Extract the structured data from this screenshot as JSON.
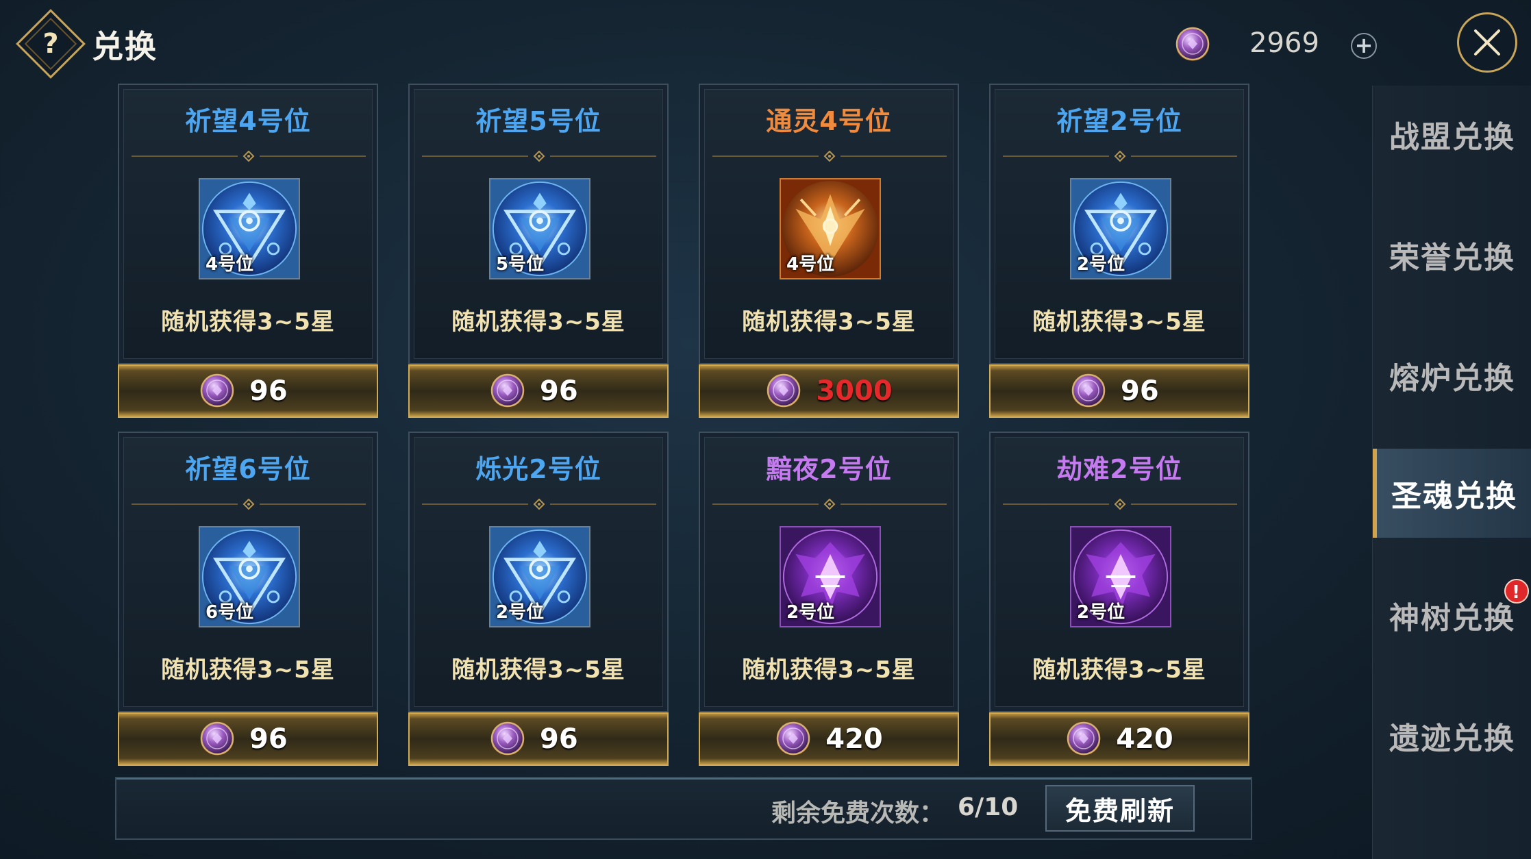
{
  "header": {
    "help_label": "?",
    "title": "兑换",
    "currency_value": "2969",
    "add_label": "+"
  },
  "sidebar": {
    "tabs": [
      {
        "label": "战盟兑换",
        "active": false,
        "badge": ""
      },
      {
        "label": "荣誉兑换",
        "active": false,
        "badge": ""
      },
      {
        "label": "熔炉兑换",
        "active": false,
        "badge": ""
      },
      {
        "label": "圣魂兑换",
        "active": true,
        "badge": ""
      },
      {
        "label": "神树兑换",
        "active": false,
        "badge": "!"
      },
      {
        "label": "遗迹兑换",
        "active": false,
        "badge": ""
      }
    ]
  },
  "items": [
    {
      "title": "祈望4号位",
      "title_color": "#4ea6f0",
      "icon": "blue-triangle-emblem-icon",
      "slot_label": "4号位",
      "desc": "随机获得3~5星",
      "price": "96",
      "affordable": true
    },
    {
      "title": "祈望5号位",
      "title_color": "#4ea6f0",
      "icon": "blue-triangle-emblem-icon",
      "slot_label": "5号位",
      "desc": "随机获得3~5星",
      "price": "96",
      "affordable": true
    },
    {
      "title": "通灵4号位",
      "title_color": "#f08a3c",
      "icon": "orange-winged-emblem-icon",
      "slot_label": "4号位",
      "desc": "随机获得3~5星",
      "price": "3000",
      "affordable": false
    },
    {
      "title": "祈望2号位",
      "title_color": "#4ea6f0",
      "icon": "blue-triangle-emblem-icon",
      "slot_label": "2号位",
      "desc": "随机获得3~5星",
      "price": "96",
      "affordable": true
    },
    {
      "title": "祈望6号位",
      "title_color": "#4ea6f0",
      "icon": "blue-triangle-emblem-icon",
      "slot_label": "6号位",
      "desc": "随机获得3~5星",
      "price": "96",
      "affordable": true
    },
    {
      "title": "烁光2号位",
      "title_color": "#4ea6f0",
      "icon": "blue-triangle-emblem-icon",
      "slot_label": "2号位",
      "desc": "随机获得3~5星",
      "price": "96",
      "affordable": true
    },
    {
      "title": "黯夜2号位",
      "title_color": "#c67af0",
      "icon": "purple-rune-emblem-icon",
      "slot_label": "2号位",
      "desc": "随机获得3~5星",
      "price": "420",
      "affordable": true
    },
    {
      "title": "劫难2号位",
      "title_color": "#c67af0",
      "icon": "purple-rune-emblem-icon",
      "slot_label": "2号位",
      "desc": "随机获得3~5星",
      "price": "420",
      "affordable": true
    }
  ],
  "footer": {
    "free_count_label": "剩余免费次数：",
    "free_count_value": "6/10",
    "refresh_label": "免费刷新"
  },
  "colors": {
    "gold_accent": "#c9a55a",
    "price_insufficient": "#e5282a",
    "blue_title": "#4ea6f0",
    "orange_title": "#f08a3c",
    "purple_title": "#c67af0"
  }
}
